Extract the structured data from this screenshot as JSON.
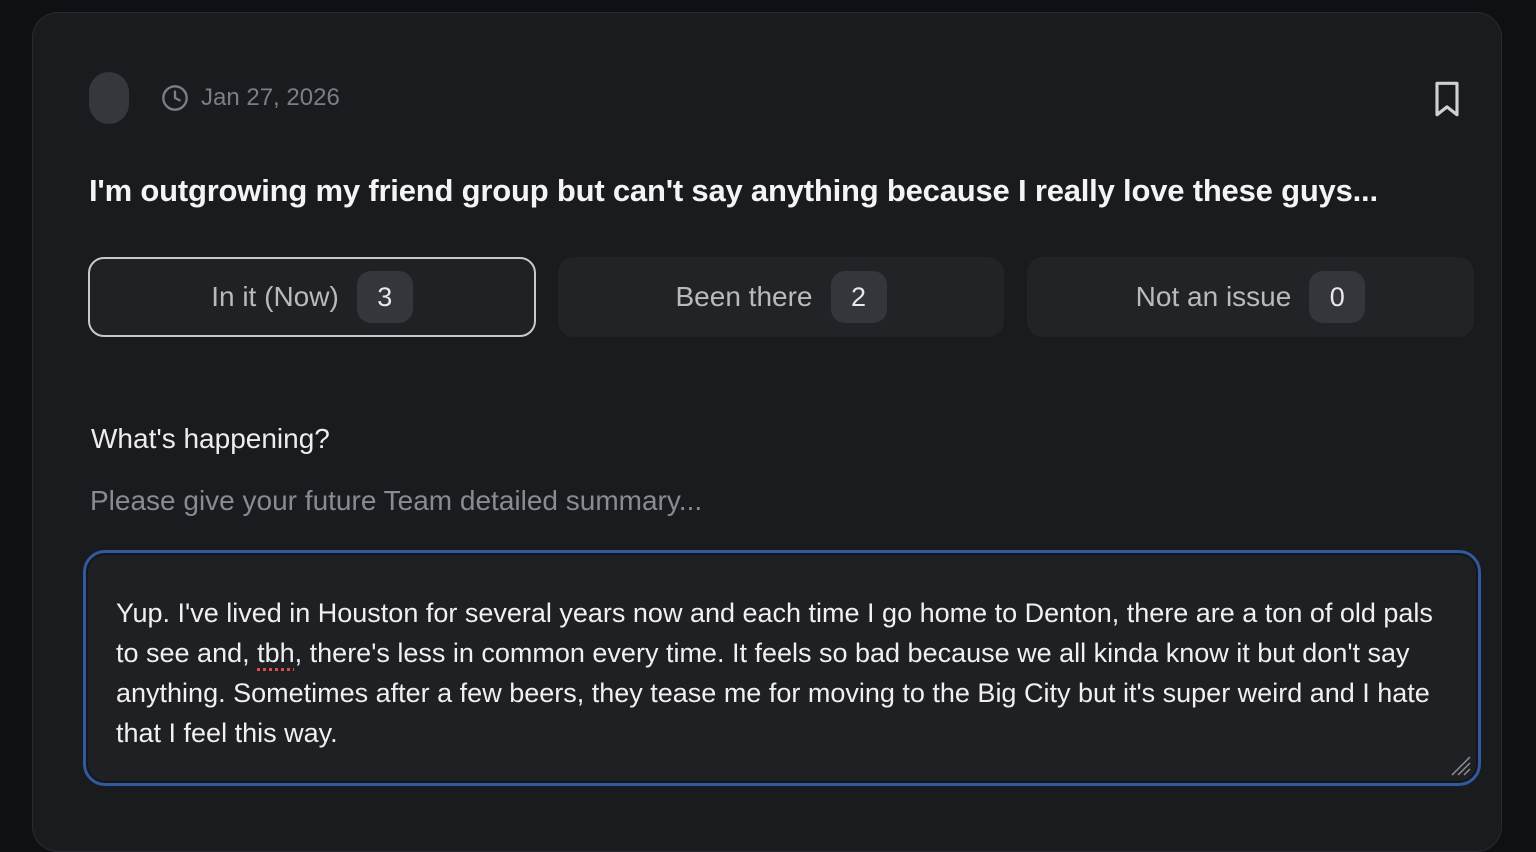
{
  "post": {
    "date": "Jan 27, 2026",
    "title": "I'm outgrowing my friend group but can't say anything because I really love these guys..."
  },
  "icons": {
    "timestamp": "clock-icon",
    "save": "bookmark-icon",
    "resize": "resize-grip-icon"
  },
  "options": [
    {
      "label": "In it (Now)",
      "count": "3",
      "selected": true
    },
    {
      "label": "Been there",
      "count": "2",
      "selected": false
    },
    {
      "label": "Not an issue",
      "count": "0",
      "selected": false
    }
  ],
  "summary": {
    "label": "What's happening?",
    "helper": "Please give your future Team detailed summary...",
    "value_before": "Yup. I've lived in Houston for several years now and each time I go home to Denton, there are a ton of old pals to see and, ",
    "value_flagged": "tbh",
    "value_after": ", there's less in common every time. It feels so bad because we all kinda know it but don't say anything. Sometimes after a few beers, they tease me for moving to the Big City but it's super weird and I hate that I feel this way."
  },
  "colors": {
    "background": "#0f1013",
    "card": "#1a1b1f",
    "focus_border": "#2f5a9e",
    "spellcheck": "#e04a4a"
  }
}
